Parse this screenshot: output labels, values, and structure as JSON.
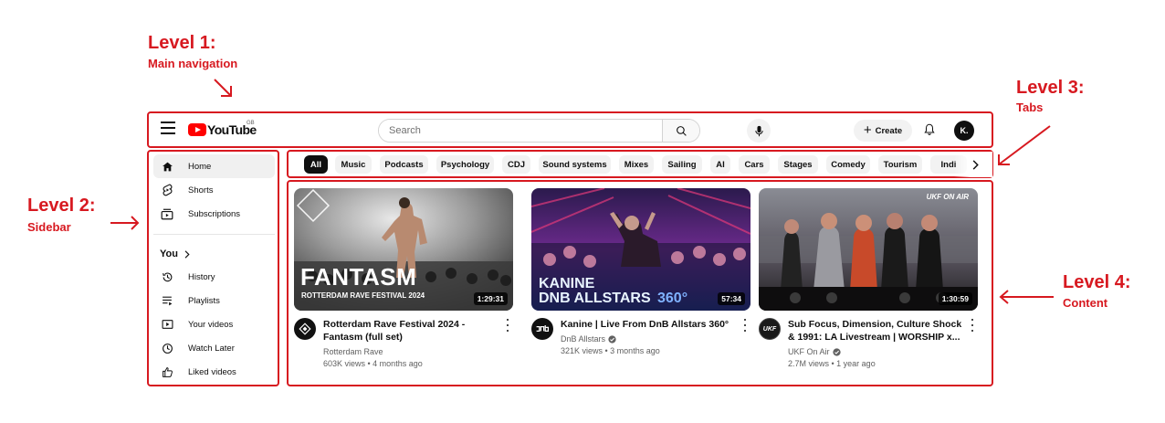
{
  "annotations": {
    "level1": {
      "title": "Level 1:",
      "subtitle": "Main navigation"
    },
    "level2": {
      "title": "Level 2:",
      "subtitle": "Sidebar"
    },
    "level3": {
      "title": "Level 3:",
      "subtitle": "Tabs"
    },
    "level4": {
      "title": "Level 4:",
      "subtitle": "Content"
    },
    "color": "#d71920"
  },
  "header": {
    "logo_text": "YouTube",
    "country_code": "GB",
    "search_placeholder": "Search",
    "create_label": "Create",
    "avatar_initial": "K."
  },
  "sidebar": {
    "items": [
      {
        "label": "Home",
        "icon": "home-icon",
        "active": true
      },
      {
        "label": "Shorts",
        "icon": "shorts-icon"
      },
      {
        "label": "Subscriptions",
        "icon": "subscriptions-icon"
      }
    ],
    "you_label": "You",
    "you_items": [
      {
        "label": "History",
        "icon": "history-icon"
      },
      {
        "label": "Playlists",
        "icon": "playlists-icon"
      },
      {
        "label": "Your videos",
        "icon": "your-videos-icon"
      },
      {
        "label": "Watch Later",
        "icon": "watch-later-icon"
      },
      {
        "label": "Liked videos",
        "icon": "liked-videos-icon"
      }
    ]
  },
  "chips": [
    "All",
    "Music",
    "Podcasts",
    "Psychology",
    "CDJ",
    "Sound systems",
    "Mixes",
    "Sailing",
    "AI",
    "Cars",
    "Stages",
    "Comedy",
    "Tourism",
    "Indi"
  ],
  "videos": [
    {
      "title": "Rotterdam Rave Festival 2024 - Fantasm (full set)",
      "channel": "Rotterdam Rave",
      "verified": false,
      "stats": "603K views • 4 months ago",
      "duration": "1:29:31",
      "thumb_text_1": "FANTASM",
      "thumb_text_2": "ROTTERDAM RAVE FESTIVAL 2024"
    },
    {
      "title": "Kanine | Live From DnB Allstars 360°",
      "channel": "DnB Allstars",
      "verified": true,
      "stats": "321K views • 3 months ago",
      "duration": "57:34",
      "thumb_text_1": "KANINE",
      "thumb_text_2": "DNB ALLSTARS",
      "thumb_text_3": "360°",
      "channel_logo": "dnb"
    },
    {
      "title": "Sub Focus, Dimension, Culture Shock & 1991: LA Livestream | WORSHIP x...",
      "channel": "UKF On Air",
      "verified": true,
      "stats": "2.7M views • 1 year ago",
      "duration": "1:30:59",
      "thumb_text_1": "UKF ON AIR",
      "channel_logo": "UKF"
    }
  ]
}
